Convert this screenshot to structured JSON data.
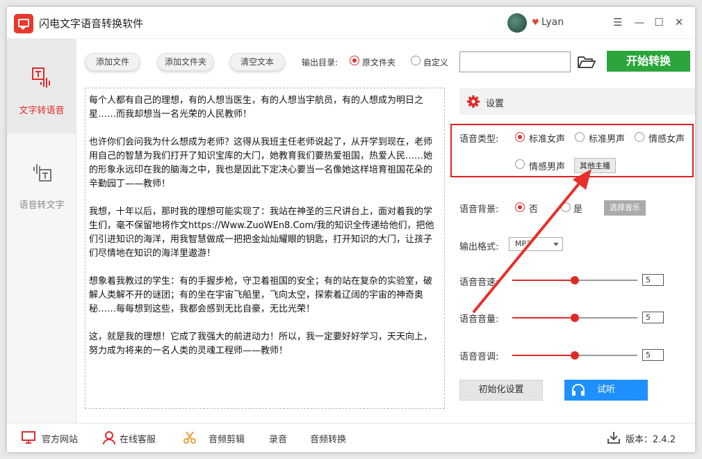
{
  "app": {
    "title": "闪电文字语音转换软件",
    "username": "Lyan"
  },
  "window_controls": {
    "menu": "☰",
    "minimize": "—",
    "maximize": "☐",
    "close": "✕"
  },
  "sidebar": {
    "items": [
      {
        "label": "文字转语音",
        "active": true
      },
      {
        "label": "语音转文字",
        "active": false
      }
    ]
  },
  "toolbar": {
    "add_file": "添加文件",
    "add_folder": "添加文件夹",
    "clear_text": "清空文本",
    "output_dir_label": "输出目录:",
    "opt_source_folder": "原文件夹",
    "opt_custom": "自定义",
    "output_path": "",
    "start_label": "开始转换"
  },
  "text_content": [
    "每个人都有自己的理想，有的人想当医生，有的人想当宇航员，有的人想成为明日之星……而我却想当一名光荣的人民教师！",
    "也许你们会问我为什么想成为老师？这得从我班主任老师说起了，从开学到现在，老师用自己的智慧为我们打开了知识宝库的大门，她教育我们要热爱祖国，热爱人民……她的形象永远印在我的脑海之中，我也是因此下定决心要当一名像她这样培育祖国花朵的辛勤园丁——教师！",
    "我想，十年以后，那时我的理想可能实现了：我站在神圣的三尺讲台上，面对着我的学生们，毫不保留地将作文https://Www.ZuoWEn8.Com/我的知识全传递给他们，把他们引进知识的海洋，用我智慧做成一把把金灿灿耀眼的钥匙，打开知识的大门，让孩子们尽情地在知识的海洋里遨游！",
    "想象着我教过的学生：有的手握步枪，守卫着祖国的安全；有的站在复杂的实验室，破解人类解不开的谜团；有的坐在宇宙飞船里，飞向太空，探索着辽阔的宇宙的神奇奥秘……每每想到这些，我都会感到无比自豪，无比光荣！",
    "这，就是我的理想！它成了我强大的前进动力！所以，我一定要好好学习，天天向上，努力成为将来的一名人类的灵魂工程师——教师！"
  ],
  "settings": {
    "title": "设置",
    "voice_type_label": "语音类型:",
    "voices": [
      "标准女声",
      "标准男声",
      "情感女声",
      "情感男声"
    ],
    "selected_voice": "标准女声",
    "other_anchor": "其他主播",
    "bg_label": "语音背景:",
    "bg_no": "否",
    "bg_yes": "是",
    "choose_music": "选择音乐",
    "format_label": "输出格式:",
    "format_value": "MP3",
    "speed_label": "语音音速:",
    "speed_value": "5",
    "volume_label": "语音音量:",
    "volume_value": "5",
    "pitch_label": "语音音调:",
    "pitch_value": "5",
    "slider_fraction": 0.5,
    "reset_label": "初始化设置",
    "listen_label": "试听"
  },
  "footer": {
    "website": "官方网站",
    "support": "在线客服",
    "audio_edit": "音频剪辑",
    "record": "录音",
    "audio_convert": "音频转换",
    "version": "版本：2.4.2"
  },
  "colors": {
    "accent": "#e02a2a",
    "start_green": "#2ca63c",
    "listen_blue": "#1e90ff"
  }
}
